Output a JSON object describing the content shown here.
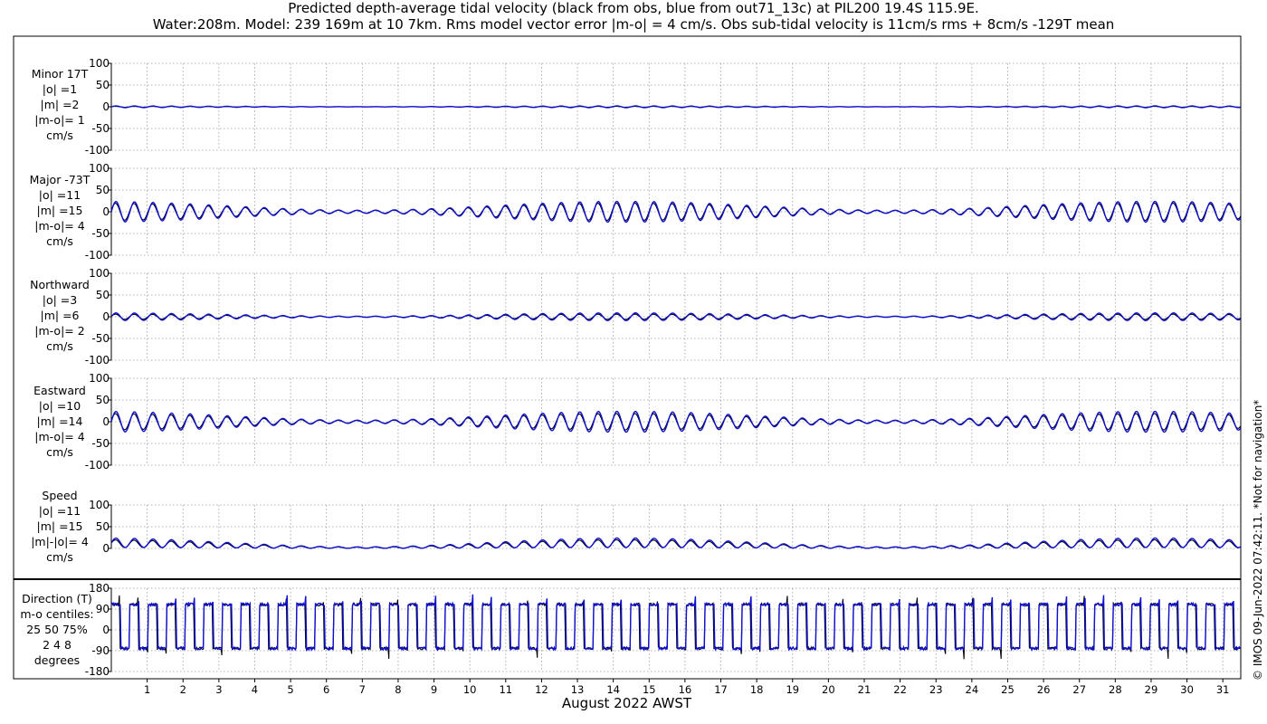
{
  "title_line1": "Predicted depth-average tidal velocity (black from obs, blue from out71_13c) at PIL200 19.4S 115.9E.",
  "title_line2": "Water:208m. Model: 239 169m at 10 7km. Rms model vector error |m-o| = 4 cm/s. Obs sub-tidal velocity is 11cm/s rms + 8cm/s -129T mean",
  "xlabel": "August 2022 AWST",
  "credit": "© IMOS 09-Jun-2022 07:42:11. *Not for navigation*",
  "colors": {
    "obs": "#000000",
    "model": "#1010d0"
  },
  "panels": [
    {
      "label": [
        "Minor 17T",
        "|o| =1",
        "|m| =2",
        "|m-o|= 1",
        "cm/s"
      ]
    },
    {
      "label": [
        "Major -73T",
        "|o| =11",
        "|m| =15",
        "|m-o|= 4",
        "cm/s"
      ]
    },
    {
      "label": [
        "Northward",
        "|o| =3",
        "|m| =6",
        "|m-o|= 2",
        "cm/s"
      ]
    },
    {
      "label": [
        "Eastward",
        "|o| =10",
        "|m| =14",
        "|m-o|= 4",
        "cm/s"
      ]
    },
    {
      "label": [
        "Speed",
        "|o| =11",
        "|m| =15",
        "|m|-|o|= 4",
        "cm/s"
      ]
    },
    {
      "label": [
        "Direction (T)",
        "m-o centiles:",
        "25  50  75%",
        "2  4  8",
        "degrees"
      ]
    }
  ],
  "chart_data": {
    "type": "line",
    "x_range": [
      0,
      31.5
    ],
    "x_ticks": [
      1,
      2,
      3,
      4,
      5,
      6,
      7,
      8,
      9,
      10,
      11,
      12,
      13,
      14,
      15,
      16,
      17,
      18,
      19,
      20,
      21,
      22,
      23,
      24,
      25,
      26,
      27,
      28,
      29,
      30,
      31
    ],
    "grid": true,
    "series_legend": [
      "black from obs",
      "blue from out71_13c"
    ],
    "subplots": [
      {
        "name": "Minor 17T",
        "ylim": [
          -100,
          100
        ],
        "yticks": [
          -100,
          -50,
          0,
          50,
          100
        ],
        "obs_amplitude": 1,
        "model_amplitude": 2,
        "kind": "tidal"
      },
      {
        "name": "Major -73T",
        "ylim": [
          -100,
          100
        ],
        "yticks": [
          -100,
          -50,
          0,
          50,
          100
        ],
        "obs_amplitude": 20,
        "model_amplitude": 24,
        "kind": "tidal"
      },
      {
        "name": "Northward",
        "ylim": [
          -100,
          100
        ],
        "yticks": [
          -100,
          -50,
          0,
          50,
          100
        ],
        "obs_amplitude": 6,
        "model_amplitude": 9,
        "kind": "tidal"
      },
      {
        "name": "Eastward",
        "ylim": [
          -100,
          100
        ],
        "yticks": [
          -100,
          -50,
          0,
          50,
          100
        ],
        "obs_amplitude": 19,
        "model_amplitude": 24,
        "kind": "tidal"
      },
      {
        "name": "Speed",
        "ylim": [
          0,
          100
        ],
        "yticks": [
          0,
          50,
          100
        ],
        "obs_amplitude": 20,
        "model_amplitude": 24,
        "kind": "speed"
      },
      {
        "name": "Direction (T)",
        "ylim": [
          -180,
          180
        ],
        "yticks": [
          -180,
          -90,
          0,
          90,
          180
        ],
        "kind": "direction",
        "levels": [
          -80,
          110
        ]
      }
    ]
  }
}
